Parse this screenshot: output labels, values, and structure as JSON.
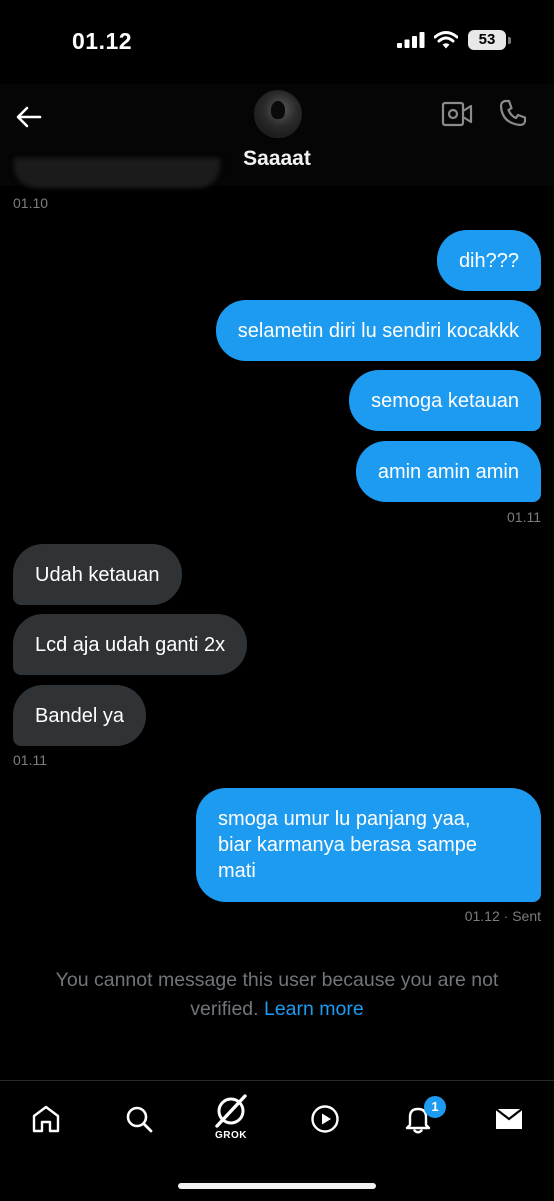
{
  "status_bar": {
    "time": "01.12",
    "battery_level": "53"
  },
  "header": {
    "contact_name": "Saaaat"
  },
  "messages": [
    {
      "side": "received",
      "time": "01.10"
    },
    {
      "side": "sent",
      "text": "dih???"
    },
    {
      "side": "sent",
      "text": "selametin diri lu sendiri kocakkk"
    },
    {
      "side": "sent",
      "text": "semoga ketauan"
    },
    {
      "side": "sent",
      "text": "amin amin amin",
      "time": "01.11"
    },
    {
      "side": "received",
      "text": "Udah ketauan"
    },
    {
      "side": "received",
      "text": "Lcd aja udah ganti 2x"
    },
    {
      "side": "received",
      "text": "Bandel ya",
      "time": "01.11"
    },
    {
      "side": "sent",
      "lines": [
        "smoga umur lu panjang yaa,",
        "biar karmanya berasa sampe",
        "mati"
      ],
      "time": "01.12 · Sent"
    }
  ],
  "notice": {
    "text": "You cannot message this user because you are not verified.",
    "link": "Learn more"
  },
  "tab_bar": {
    "items": [
      "home-icon",
      "search-icon",
      "grok-icon",
      "video-icon",
      "notifications-icon",
      "messages-icon"
    ],
    "grok_label": "GROK",
    "notifications_badge": "1"
  },
  "colors": {
    "accent": "#1d9bf0",
    "received_bubble": "#2f3336",
    "background": "#000000",
    "muted_text": "#71767b"
  }
}
